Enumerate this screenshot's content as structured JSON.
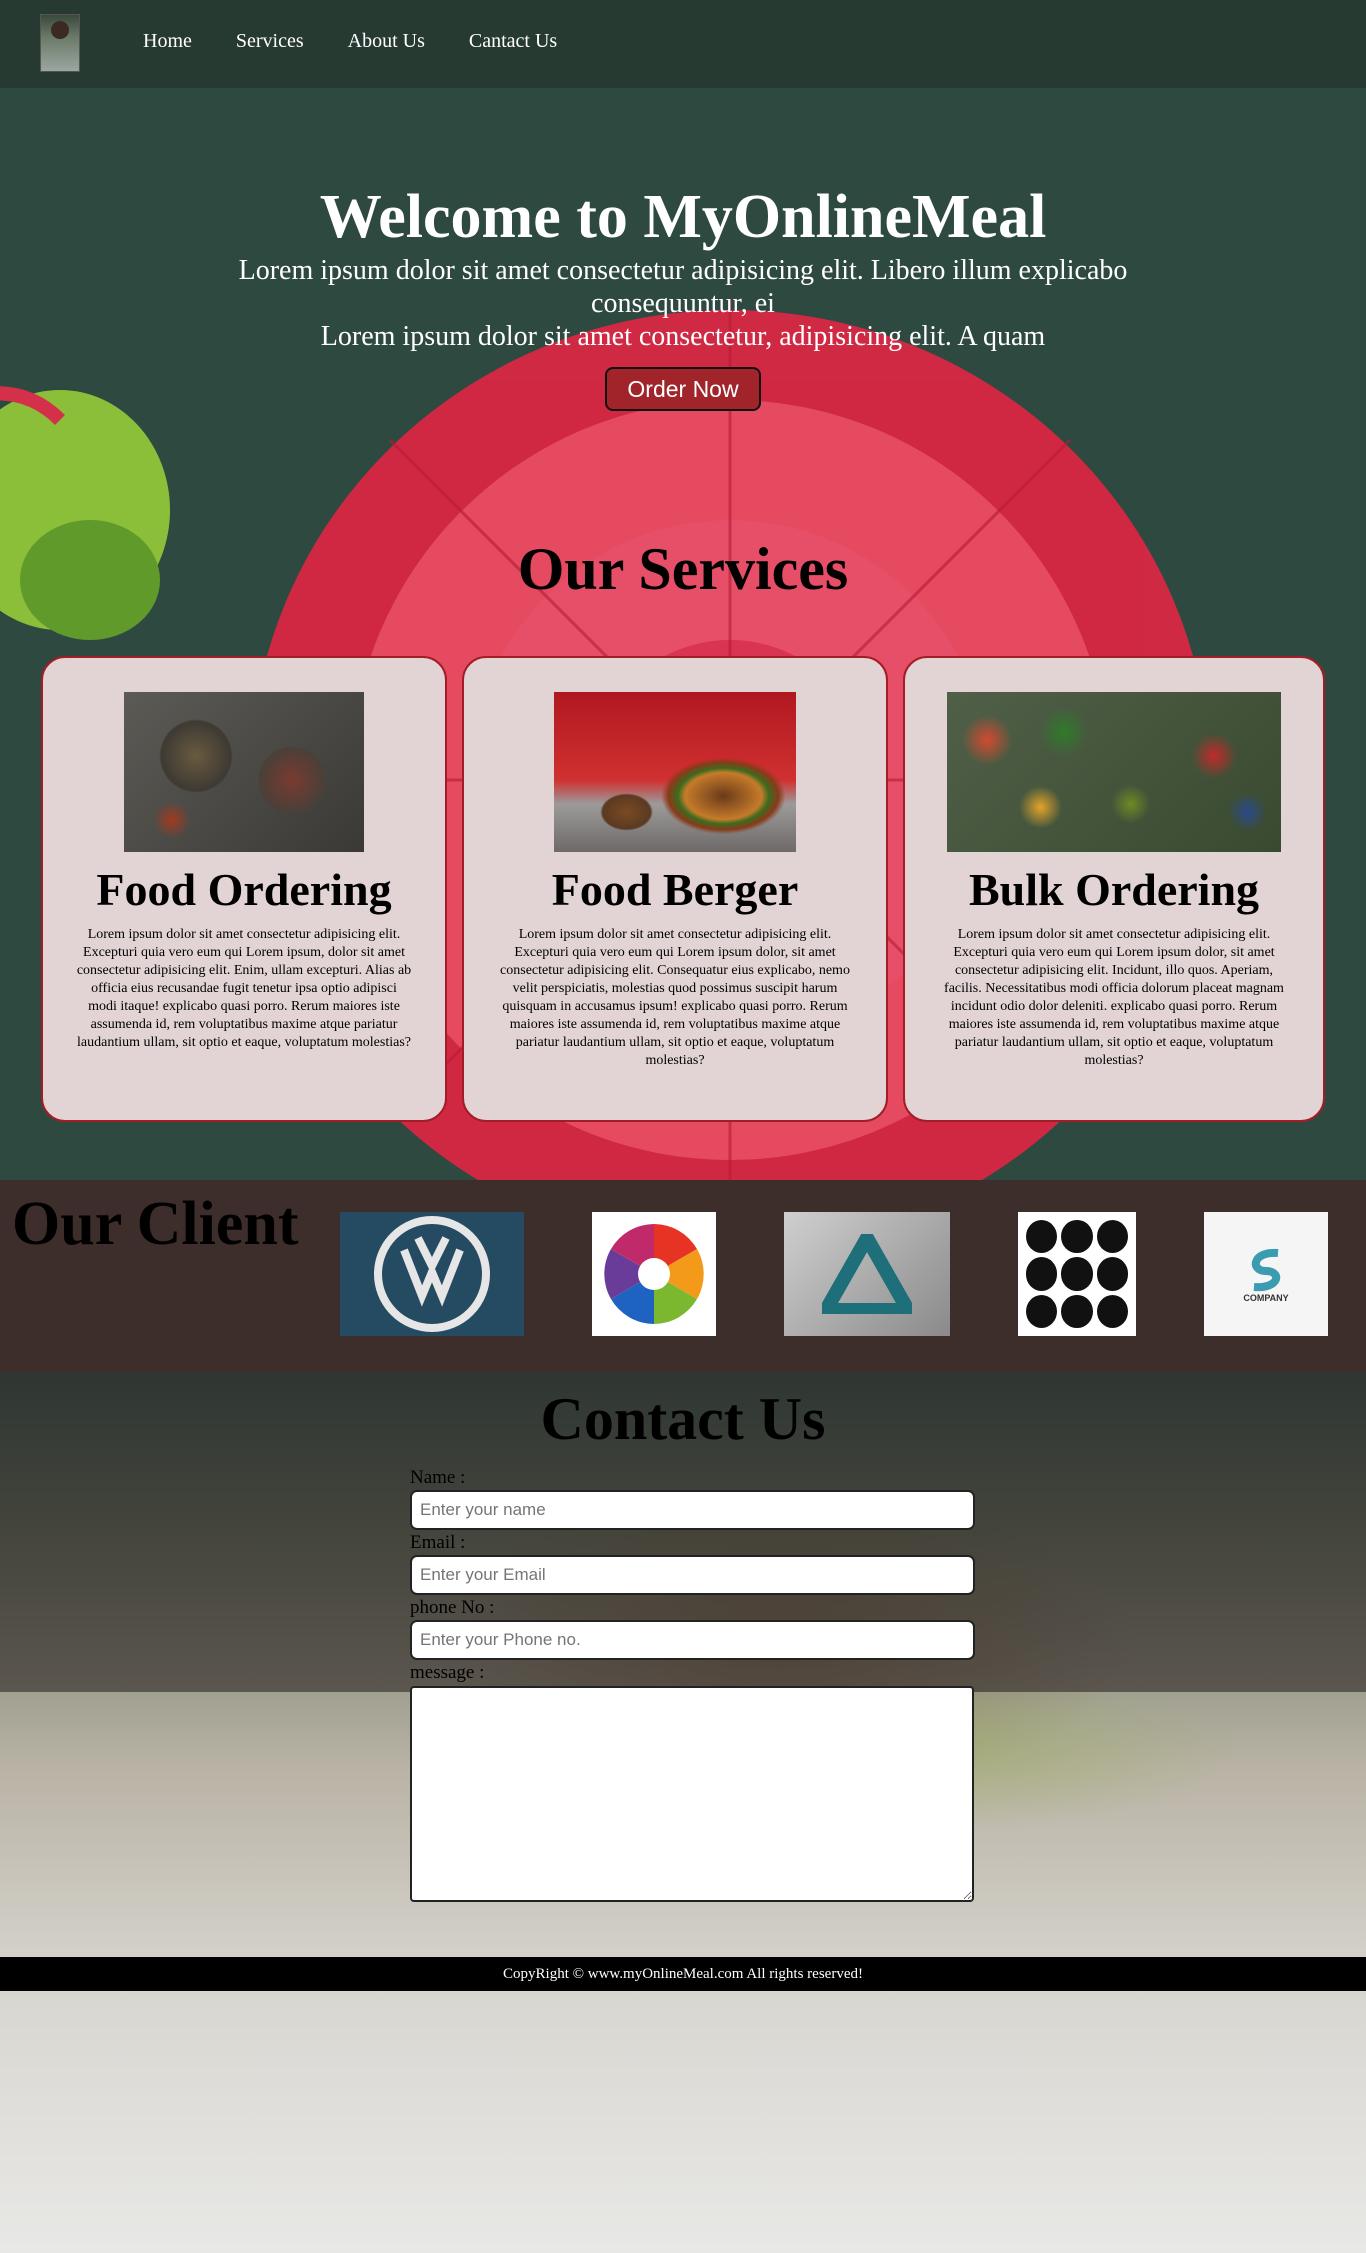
{
  "nav": {
    "links": [
      "Home",
      "Services",
      "About Us",
      "Cantact Us"
    ]
  },
  "hero": {
    "title": "Welcome to MyOnlineMeal",
    "line1": "Lorem ipsum dolor sit amet consectetur adipisicing elit. Libero illum explicabo consequuntur, ei",
    "line2": "Lorem ipsum dolor sit amet consectetur, adipisicing elit. A quam",
    "button": "Order Now"
  },
  "services": {
    "title": "Our Services",
    "cards": [
      {
        "title": "Food Ordering",
        "text": "Lorem ipsum dolor sit amet consectetur adipisicing elit. Excepturi quia vero eum qui Lorem ipsum, dolor sit amet consectetur adipisicing elit. Enim, ullam excepturi. Alias ab officia eius recusandae fugit tenetur ipsa optio adipisci modi itaque! explicabo quasi porro. Rerum maiores iste assumenda id, rem voluptatibus maxime atque pariatur laudantium ullam, sit optio et eaque, voluptatum molestias?"
      },
      {
        "title": "Food Berger",
        "text": "Lorem ipsum dolor sit amet consectetur adipisicing elit. Excepturi quia vero eum qui Lorem ipsum dolor, sit amet consectetur adipisicing elit. Consequatur eius explicabo, nemo velit perspiciatis, molestias quod possimus suscipit harum quisquam in accusamus ipsum! explicabo quasi porro. Rerum maiores iste assumenda id, rem voluptatibus maxime atque pariatur laudantium ullam, sit optio et eaque, voluptatum molestias?"
      },
      {
        "title": "Bulk Ordering",
        "text": "Lorem ipsum dolor sit amet consectetur adipisicing elit. Excepturi quia vero eum qui Lorem ipsum dolor, sit amet consectetur adipisicing elit. Incidunt, illo quos. Aperiam, facilis. Necessitatibus modi officia dolorum placeat magnam incidunt odio dolor deleniti. explicabo quasi porro. Rerum maiores iste assumenda id, rem voluptatibus maxime atque pariatur laudantium ullam, sit optio et eaque, voluptatum molestias?"
      }
    ]
  },
  "clients": {
    "title": "Our Client",
    "company_logo_text": "COMPANY"
  },
  "contact": {
    "title": "Contact Us",
    "name_label": "Name :",
    "name_placeholder": "Enter your name",
    "email_label": "Email :",
    "email_placeholder": "Enter your Email",
    "phone_label": "phone No :",
    "phone_placeholder": "Enter your Phone no.",
    "message_label": "message :"
  },
  "footer": {
    "text": "CopyRight © www.myOnlineMeal.com All rights reserved!"
  },
  "colors": {
    "nav_bg": "#263a32",
    "page_bg": "#2e4a40",
    "button_bg": "#a0242a",
    "card_bg": "#e2d3d4",
    "card_border": "#a21d25",
    "footer_bg": "#000000"
  }
}
